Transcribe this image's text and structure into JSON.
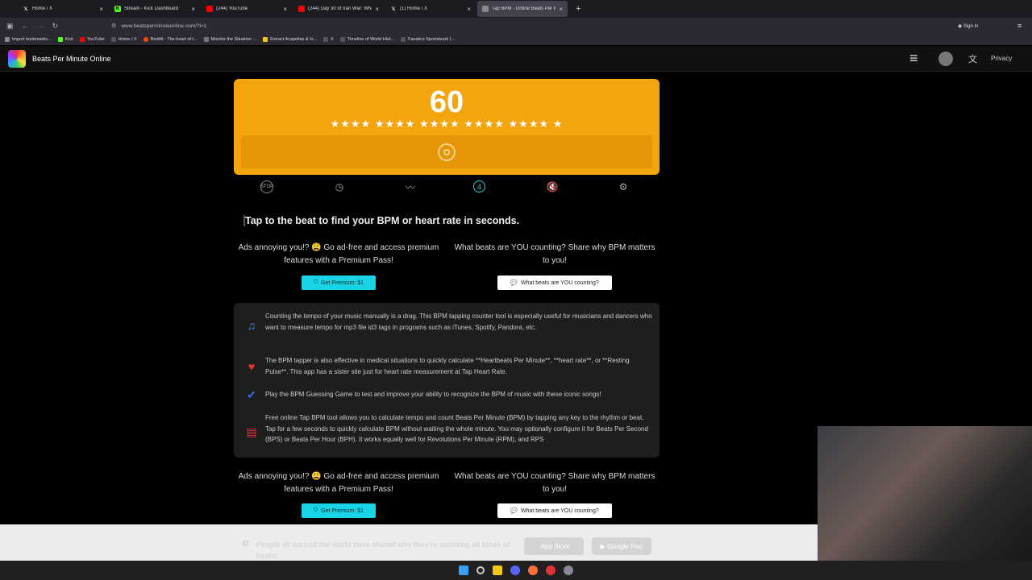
{
  "browser": {
    "tabs": [
      {
        "label": "Home / X",
        "color": "#000000"
      },
      {
        "label": "Stream - Kick Dashboard",
        "color": "#53fc18"
      },
      {
        "label": "(244) YouTube",
        "color": "#ff0000"
      },
      {
        "label": "(244) Day 30 of Iran War: What",
        "color": "#ff0000"
      },
      {
        "label": "(1) Home / X",
        "color": "#000000"
      },
      {
        "label": "Tap BPM - Online Beats Per Mi",
        "color": "#888888"
      }
    ],
    "url": "www.beatsperminuteonline.com/?l=1",
    "sign_in": "Sign in",
    "bookmarks": [
      "Import bookmarks...",
      "Kick",
      "YouTube",
      "Home / X",
      "Reddit - The heart of t...",
      "Monitor the Situation ...",
      "Extract Acapellas & In...",
      "X",
      "Timeline of World Hist...",
      "Fanatics Sportsbook (..."
    ]
  },
  "site": {
    "title": "Beats Per Minute Online",
    "privacy": "Privacy"
  },
  "bpm": {
    "value": "60",
    "stars": "★★★★ ★★★★ ★★★★ ★★★★ ★★★★ ★"
  },
  "heading": "Tap to the beat to find your BPM or heart rate in seconds.",
  "cta": {
    "ads_line1": "Ads annoying you!? 😩 Go ad-free and access premium",
    "ads_line2": "features with a Premium Pass!",
    "share_line1": "What beats are YOU counting? Share why BPM matters",
    "share_line2": "to you!",
    "premium_button": "Get Premium: $1",
    "count_button": "What beats are YOU counting?"
  },
  "info": [
    {
      "text": "Counting the tempo of your music manually is a drag. This BPM tapping counter tool is especially useful for musicians and dancers who want to measure tempo for mp3 file id3 tags in programs such as iTunes, Spotify, Pandora, etc."
    },
    {
      "text": "The BPM tapper is also effective in medical situations to quickly calculate **Heartbeats Per Minute**, **heart rate**, or **Resting Pulse**. This app has a sister site just for heart rate measurement at Tap Heart Rate."
    },
    {
      "text": "Play the BPM Guessing Game to test and improve your ability to recognize the BPM of music with these iconic songs!"
    },
    {
      "text": "Free online Tap BPM tool allows you to calculate tempo and count Beats Per Minute (BPM) by tapping any key to the rhythm or beat. Tap for a few seconds to quickly calculate BPM without waiting the whole minute. You may optionally configure it for Beats Per Second (BPS) or Beats Per Hour (BPH). It works equally well for Revolutions Per Minute (RPM), and RPS"
    }
  ],
  "banner": {
    "text": "People all around the world have shared why they're counting all kinds of beats!",
    "app_store": "App Store",
    "google_play": "Google Play"
  },
  "colors": {
    "pad": "#f4a40c",
    "premium": "#19d3e6",
    "link": "#f5c518"
  }
}
